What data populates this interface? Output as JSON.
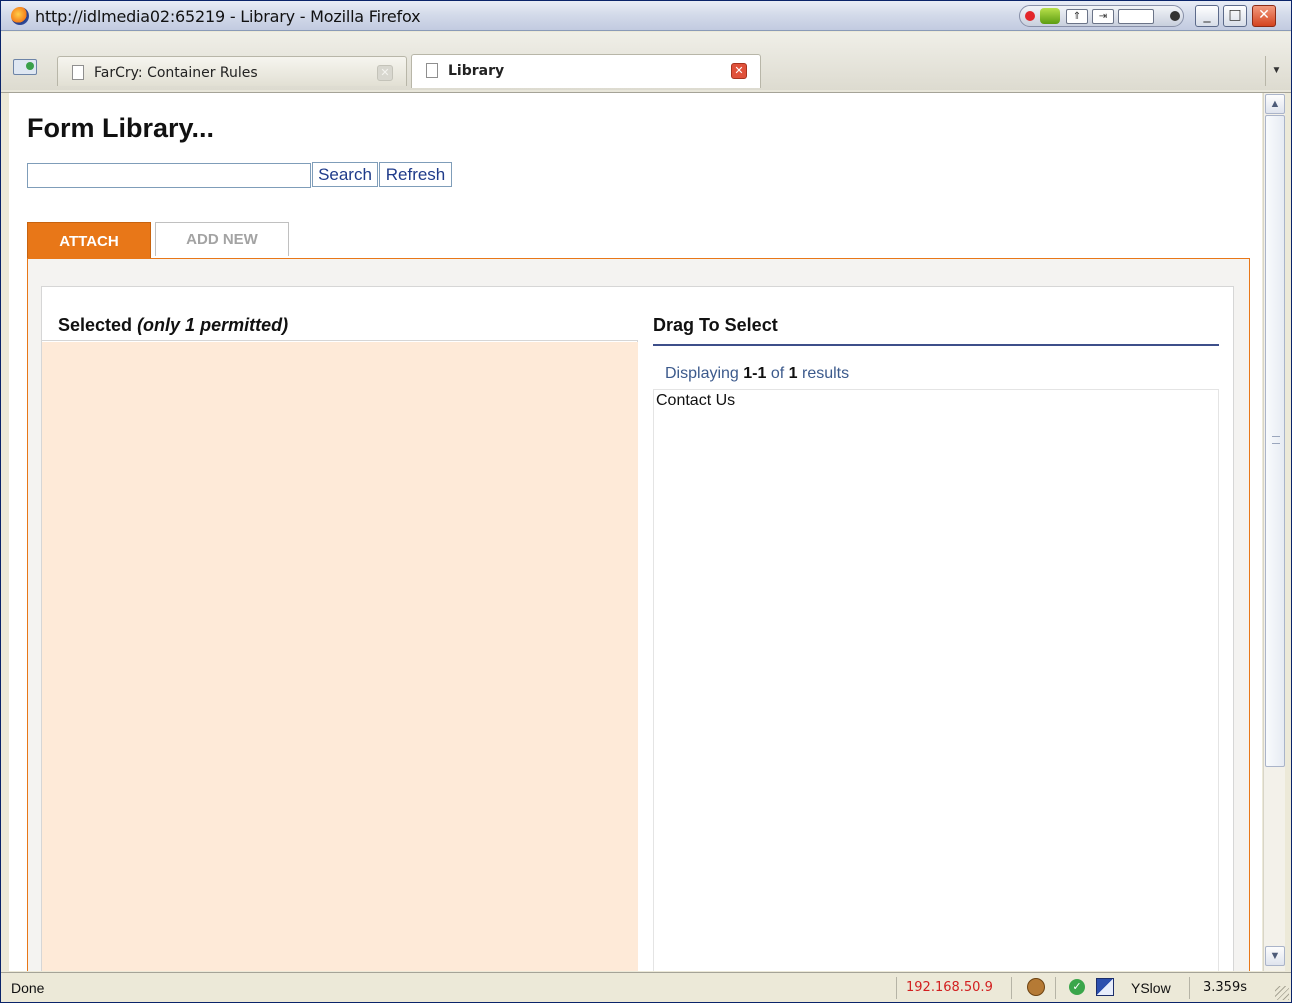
{
  "window": {
    "title": "http://idlmedia02:65219 - Library - Mozilla Firefox",
    "controls": {
      "minimize": "_",
      "maximize": "□",
      "close": "✕"
    }
  },
  "tabs": [
    {
      "label": "FarCry: Container Rules",
      "active": false
    },
    {
      "label": "Library",
      "active": true
    }
  ],
  "page": {
    "title": "Form Library...",
    "search": {
      "value": "",
      "placeholder": ""
    },
    "buttons": {
      "search": "Search",
      "refresh": "Refresh"
    },
    "library_tabs": {
      "attach": "ATTACH",
      "add_new": "ADD NEW"
    },
    "selected": {
      "title": "Selected",
      "note": "(only 1 permitted)"
    },
    "drag": {
      "title": "Drag To Select",
      "pager": {
        "prefix": "Displaying",
        "range": "1-1",
        "of": "of",
        "total": "1",
        "suffix": "results"
      },
      "items": [
        "Contact Us"
      ]
    }
  },
  "statusbar": {
    "text": "Done",
    "ip": "192.168.50.9",
    "yslow": "YSlow",
    "time": "3.359s"
  },
  "colors": {
    "accent": "#e87718",
    "selected_bg": "#feead8",
    "link": "#3c5a8c"
  },
  "icons": [
    "firefox-icon",
    "page-icon",
    "close-icon",
    "new-tab-icon",
    "nvidia-icon",
    "monkey-icon",
    "check-icon",
    "yslow-icon"
  ]
}
